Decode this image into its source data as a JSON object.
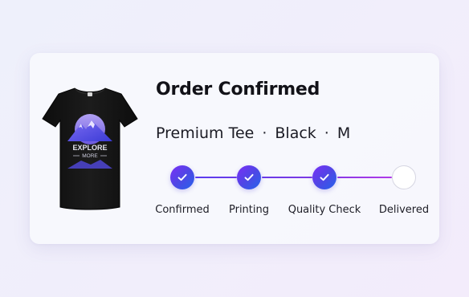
{
  "order": {
    "title": "Order Confirmed",
    "product_name": "Premium Tee",
    "separator": "·",
    "color": "Black",
    "size": "M"
  },
  "product_image": {
    "graphic_text_line1": "EXPLORE",
    "graphic_text_line2": "MORE",
    "shirt_color": "#141414",
    "graphic_colors": [
      "#3b3bd6",
      "#7c6cf2",
      "#b9a8ff"
    ]
  },
  "tracker": {
    "steps": [
      {
        "label": "Confirmed",
        "status": "complete"
      },
      {
        "label": "Printing",
        "status": "complete"
      },
      {
        "label": "Quality Check",
        "status": "complete"
      },
      {
        "label": "Delivered",
        "status": "pending"
      }
    ],
    "accent_gradient": [
      "#7b2ff7",
      "#4f46e5",
      "#2563eb"
    ]
  }
}
